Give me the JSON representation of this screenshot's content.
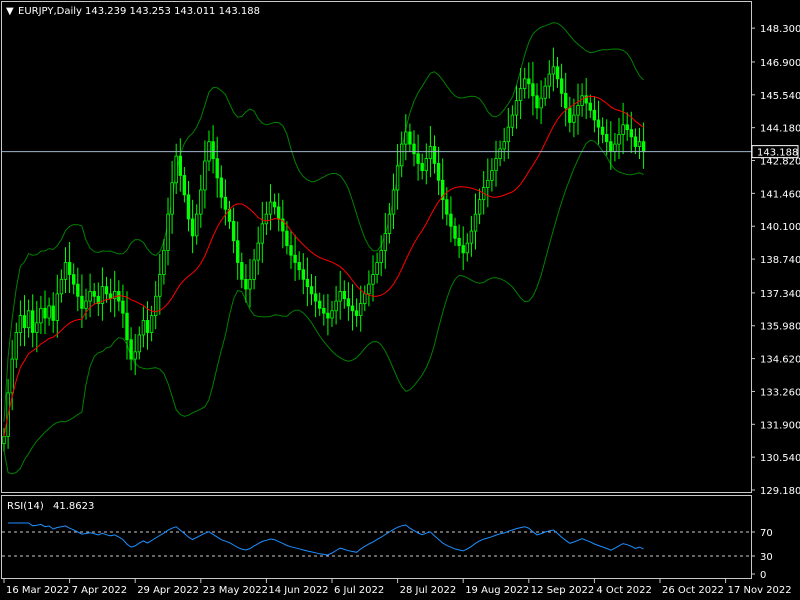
{
  "header": {
    "triangle_glyph": "▼",
    "symbol": "EURJPY,Daily",
    "ohlc": "143.239 143.253 143.011 143.188"
  },
  "rsi_header": {
    "label": "RSI(14)",
    "value": "41.8623"
  },
  "colors": {
    "background": "#000000",
    "frame": "#c8c8c8",
    "candle": "#00ff00",
    "ma": "#ff0000",
    "bands": "#008000",
    "rsi_line": "#1e90ff",
    "level_line": "#c8c8c8",
    "price_line": "#9fb6cd",
    "text": "#ffffff"
  },
  "chart_data": [
    {
      "type": "candlestick",
      "title": "EURJPY,Daily",
      "indicators": [
        "Bollinger Bands",
        "Moving Average"
      ],
      "ylim": [
        129.18,
        149.3
      ],
      "y_ticks": [
        "148.300",
        "146.900",
        "145.540",
        "144.180",
        "142.820",
        "141.460",
        "140.100",
        "138.740",
        "137.340",
        "135.980",
        "134.620",
        "133.260",
        "131.900",
        "130.540",
        "129.180"
      ],
      "y_tick_values": [
        148.3,
        146.9,
        145.54,
        144.18,
        142.82,
        141.46,
        140.1,
        138.74,
        137.34,
        135.98,
        134.62,
        133.26,
        131.9,
        130.54,
        129.18
      ],
      "current_price_label": "143.188",
      "current_price": 143.188,
      "x_ticks": [
        "16 Mar 2022",
        "7 Apr 2022",
        "29 Apr 2022",
        "23 May 2022",
        "14 Jun 2022",
        "6 Jul 2022",
        "28 Jul 2022",
        "19 Aug 2022",
        "12 Sep 2022",
        "4 Oct 2022",
        "26 Oct 2022",
        "17 Nov 2022"
      ],
      "x_tick_bar_index": [
        0,
        16,
        32,
        48,
        64,
        80,
        96,
        112,
        128,
        144,
        160,
        176
      ],
      "close": [
        131.4,
        133.2,
        134.6,
        135.7,
        136.4,
        135.9,
        136.6,
        135.7,
        136.1,
        136.7,
        136.3,
        136.8,
        136.2,
        137.3,
        137.9,
        138.6,
        138.1,
        137.7,
        137.2,
        136.7,
        137.0,
        137.4,
        137.2,
        136.9,
        137.6,
        137.3,
        137.1,
        137.4,
        137.0,
        136.5,
        135.4,
        134.6,
        134.9,
        135.6,
        136.2,
        135.7,
        136.4,
        137.2,
        138.1,
        139.1,
        140.6,
        141.9,
        143.0,
        142.2,
        141.4,
        140.4,
        139.7,
        140.6,
        141.6,
        142.8,
        143.6,
        142.9,
        142.1,
        141.3,
        140.8,
        140.3,
        139.5,
        138.6,
        137.9,
        137.5,
        137.9,
        138.7,
        139.4,
        140.2,
        140.6,
        141.1,
        140.9,
        140.4,
        139.9,
        139.3,
        138.9,
        138.6,
        138.3,
        137.9,
        137.6,
        137.3,
        137.0,
        136.7,
        136.5,
        136.3,
        136.6,
        137.0,
        137.4,
        137.1,
        136.8,
        136.6,
        136.4,
        136.9,
        137.3,
        137.7,
        138.1,
        138.6,
        139.1,
        139.8,
        140.6,
        141.6,
        142.6,
        143.5,
        144.0,
        143.5,
        143.1,
        142.7,
        142.4,
        142.9,
        143.4,
        142.7,
        142.0,
        141.2,
        140.6,
        140.1,
        139.6,
        139.3,
        139.0,
        139.4,
        139.9,
        140.6,
        141.2,
        141.7,
        142.0,
        142.4,
        142.9,
        143.3,
        143.6,
        144.2,
        144.7,
        145.3,
        145.8,
        146.2,
        146.0,
        145.5,
        145.0,
        145.4,
        145.9,
        146.4,
        146.7,
        146.2,
        145.6,
        145.0,
        144.4,
        144.7,
        145.1,
        145.5,
        145.2,
        144.9,
        144.5,
        144.2,
        143.9,
        143.6,
        143.2,
        143.5,
        143.9,
        144.3,
        144.1,
        143.8,
        143.4,
        143.6,
        143.188
      ],
      "rsi": {
        "label": "RSI(14)",
        "value": 41.8623,
        "ylim": [
          0,
          100
        ],
        "y_ticks": [
          "70",
          "30",
          "0"
        ],
        "y_tick_values": [
          70,
          30,
          0
        ],
        "levels": [
          70,
          30
        ]
      }
    }
  ]
}
